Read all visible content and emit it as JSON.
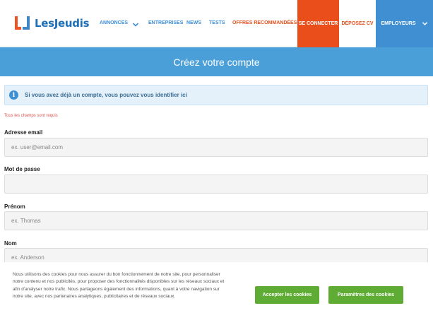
{
  "brand": {
    "name": "LesJeudis"
  },
  "nav": {
    "links": [
      "ANNONCES",
      "ENTREPRISES",
      "NEWS",
      "TESTS",
      "OFFRES RECOMMANDÉES"
    ],
    "connect": "SE CONNECTER",
    "cv": "DÉPOSEZ CV",
    "employers": "EMPLOYEURS"
  },
  "banner": {
    "title": "Créez votre compte"
  },
  "info": {
    "text": "Si vous avez déjà un compte, vous pouvez vous identifier ici"
  },
  "form": {
    "required_note": "Tous les champs sont requis",
    "email": {
      "label": "Adresse email",
      "placeholder": "ex. user@email.com"
    },
    "password": {
      "label": "Mot de passe",
      "placeholder": ""
    },
    "firstname": {
      "label": "Prénom",
      "placeholder": "ex. Thomas"
    },
    "lastname": {
      "label": "Nom",
      "placeholder": "ex. Anderson"
    }
  },
  "cookie": {
    "text": "Nous utilisons des cookies pour nous assurer du bon fonctionnement de notre site, pour personnaliser notre contenu et nos publicités, pour proposer des fonctionnalités disponibles sur les réseaux sociaux et afin d'analyser notre trafic. Nous partageons également des informations, quant à votre navigation sur notre site, avec nos partenaires analytiques, publicitaires et de réseaux sociaux.",
    "accept": "Accepter les cookies",
    "settings": "Paramètres des cookies"
  },
  "colors": {
    "accent_blue": "#4a9fd9",
    "accent_orange": "#ea4f1b",
    "cookie_green": "#5fac34"
  },
  "icons": {
    "info": "info-circle-icon",
    "dropdown": "chevron-down-icon"
  }
}
